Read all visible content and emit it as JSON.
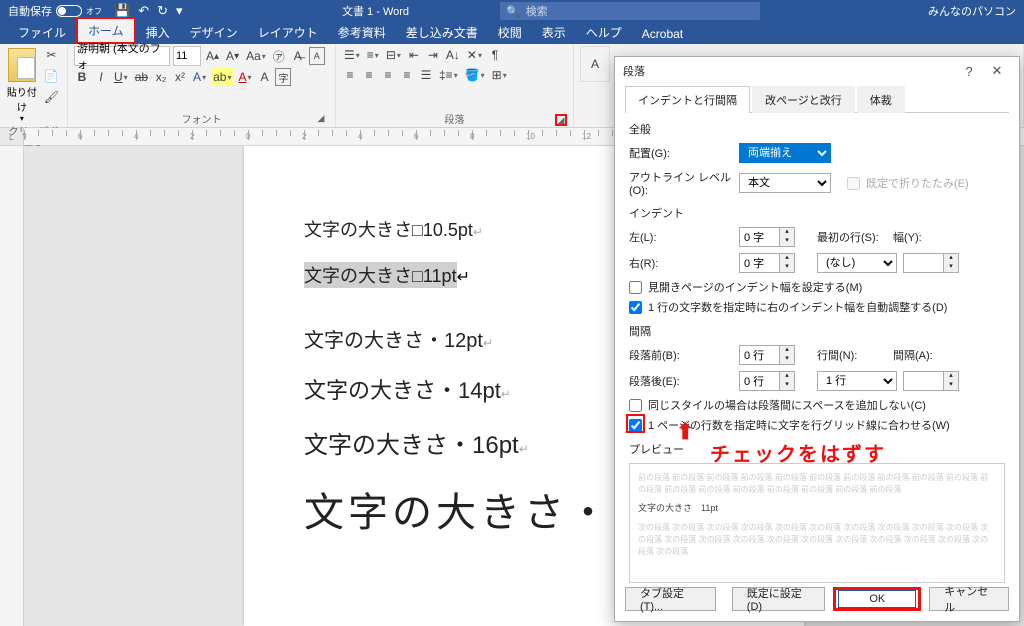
{
  "titlebar": {
    "autosave_label": "自動保存",
    "autosave_state": "オフ",
    "doc_title": "文書 1 - Word",
    "search_placeholder": "検索",
    "brand": "みんなのパソコン"
  },
  "menus": [
    "ファイル",
    "ホーム",
    "挿入",
    "デザイン",
    "レイアウト",
    "参考資料",
    "差し込み文書",
    "校閲",
    "表示",
    "ヘルプ",
    "Acrobat"
  ],
  "ribbon": {
    "clipboard_label": "クリップボード",
    "paste_label": "貼り付け",
    "font_name": "游明朝 (本文のフォ",
    "font_size": "11",
    "font_group_label": "フォント",
    "para_group_label": "段落"
  },
  "document": {
    "lines": [
      "文字の大きさ□10.5pt",
      "文字の大きさ□11pt",
      "文字の大きさ・12pt",
      "文字の大きさ・14pt",
      "文字の大きさ・16pt",
      "文字の大きさ・"
    ]
  },
  "dialog": {
    "title": "段落",
    "tabs": [
      "インデントと行間隔",
      "改ページと改行",
      "体裁"
    ],
    "general_hdr": "全般",
    "align_label": "配置(G):",
    "align_value": "両端揃え",
    "outline_label": "アウトライン レベル(O):",
    "outline_value": "本文",
    "collapse_label": "既定で折りたたみ(E)",
    "indent_hdr": "インデント",
    "left_label": "左(L):",
    "left_value": "0 字",
    "right_label": "右(R):",
    "right_value": "0 字",
    "firstline_label": "最初の行(S):",
    "firstline_value": "(なし)",
    "width_label": "幅(Y):",
    "mirror_label": "見開きページのインデント幅を設定する(M)",
    "autoadjust_label": "1 行の文字数を指定時に右のインデント幅を自動調整する(D)",
    "spacing_hdr": "間隔",
    "before_label": "段落前(B):",
    "before_value": "0 行",
    "after_label": "段落後(E):",
    "after_value": "0 行",
    "linespacing_label": "行間(N):",
    "linespacing_value": "1 行",
    "spacing_at_label": "間隔(A):",
    "samestyle_label": "同じスタイルの場合は段落間にスペースを追加しない(C)",
    "snapgrid_label": "1 ページの行数を指定時に文字を行グリッド線に合わせる(W)",
    "preview_hdr": "プレビュー",
    "preview_sample": "文字の大きさ　11pt",
    "preview_prev": "前の段落 前の段落 前の段落 前の段落 前の段落 前の段落 前の段落 前の段落 前の段落 前の段落 前の段落 前の段落 前の段落 前の段落 前の段落 前の段落 前の段落 前の段落",
    "preview_next": "次の段落 次の段落 次の段落 次の段落 次の段落 次の段落 次の段落 次の段落 次の段落 次の段落 次の段落 次の段落 次の段落 次の段落 次の段落 次の段落 次の段落 次の段落 次の段落 次の段落 次の段落 次の段落",
    "tab_btn": "タブ設定(T)...",
    "default_btn": "既定に設定(D)",
    "ok_btn": "OK",
    "cancel_btn": "キャンセル"
  },
  "annotation": "チェックをはずす"
}
